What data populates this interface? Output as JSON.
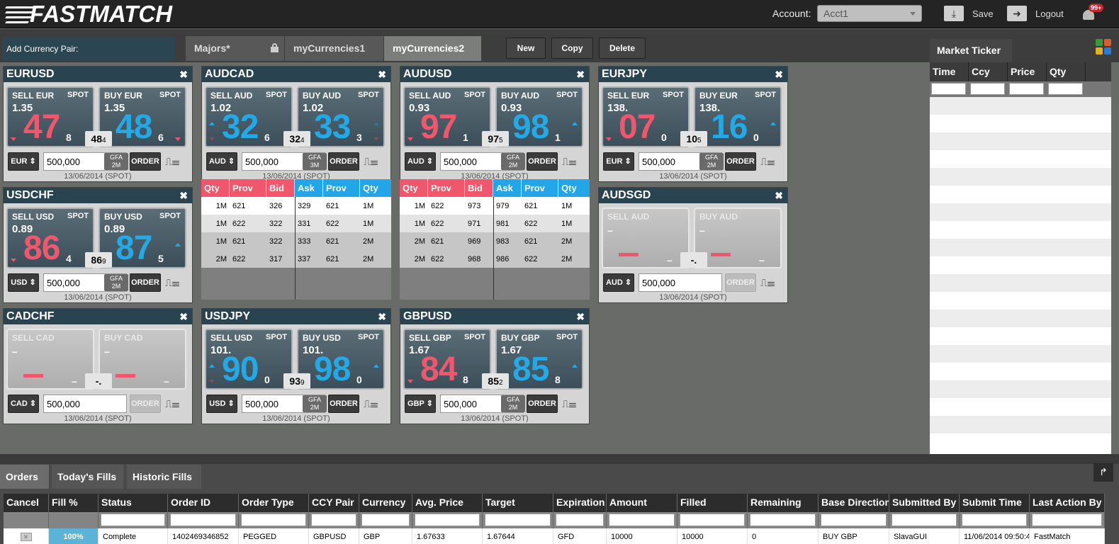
{
  "app": {
    "logo": "FASTMATCH",
    "account_label": "Account:",
    "account_value": "Acct1",
    "save": "Save",
    "logout": "Logout",
    "notifications": "99+"
  },
  "workspace": {
    "add_pair": "Add Currency Pair:",
    "tabs": [
      "Majors*",
      "myCurrencies1",
      "myCurrencies2"
    ],
    "actions": [
      "New",
      "Copy",
      "Delete"
    ]
  },
  "tiles": [
    {
      "pair": "EURUSD",
      "sell": "SELL EUR",
      "buy": "BUY EUR",
      "spot": "SPOT",
      "sell_fig": "1.35",
      "sell_big": "47",
      "sell_pip": "8",
      "buy_fig": "1.35",
      "buy_big": "48",
      "buy_pip": "6",
      "spread": "48",
      "spread_sub": "4",
      "ccy": "EUR",
      "amount": "500,000",
      "gfa": "GFA",
      "gfa2": "2M",
      "order": "ORDER",
      "date": "13/06/2014 (SPOT)"
    },
    {
      "pair": "AUDCAD",
      "sell": "SELL AUD",
      "buy": "BUY AUD",
      "spot": "SPOT",
      "sell_fig": "1.02",
      "sell_big": "32",
      "sell_pip": "6",
      "buy_fig": "1.02",
      "buy_big": "33",
      "buy_pip": "3",
      "spread": "32",
      "spread_sub": "4",
      "ccy": "AUD",
      "amount": "500,000",
      "gfa": "GFA",
      "gfa2": "3M",
      "order": "ORDER",
      "date": "13/06/2014 (SPOT)"
    },
    {
      "pair": "AUDUSD",
      "sell": "SELL AUD",
      "buy": "BUY AUD",
      "spot": "SPOT",
      "sell_fig": "0.93",
      "sell_big": "97",
      "sell_pip": "1",
      "buy_fig": "0.93",
      "buy_big": "98",
      "buy_pip": "1",
      "spread": "97",
      "spread_sub": "5",
      "ccy": "AUD",
      "amount": "500,000",
      "gfa": "GFA",
      "gfa2": "2M",
      "order": "ORDER",
      "date": "13/06/2014 (SPOT)"
    },
    {
      "pair": "EURJPY",
      "sell": "SELL EUR",
      "buy": "BUY EUR",
      "spot": "SPOT",
      "sell_fig": "138.",
      "sell_big": "07",
      "sell_pip": "0",
      "buy_fig": "138.",
      "buy_big": "16",
      "buy_pip": "0",
      "spread": "10",
      "spread_sub": "5",
      "ccy": "EUR",
      "amount": "500,000",
      "gfa": "GFA",
      "gfa2": "2M",
      "order": "ORDER",
      "date": "13/06/2014 (SPOT)"
    },
    {
      "pair": "USDCHF",
      "sell": "SELL USD",
      "buy": "BUY USD",
      "spot": "SPOT",
      "sell_fig": "0.89",
      "sell_big": "86",
      "sell_pip": "4",
      "buy_fig": "0.89",
      "buy_big": "87",
      "buy_pip": "5",
      "spread": "86",
      "spread_sub": "9",
      "ccy": "USD",
      "amount": "500,000",
      "gfa": "GFA",
      "gfa2": "2M",
      "order": "ORDER",
      "date": "13/06/2014 (SPOT)"
    },
    {
      "pair": "AUDSGD",
      "sell": "SELL AUD",
      "buy": "BUY AUD",
      "dash": "–",
      "spread": "-.",
      "ccy": "AUD",
      "amount": "500,000",
      "order": "ORDER",
      "date": "13/06/2014 (SPOT)"
    },
    {
      "pair": "CADCHF",
      "sell": "SELL CAD",
      "buy": "BUY CAD",
      "dash": "–",
      "spread": "-.",
      "ccy": "CAD",
      "amount": "500,000",
      "order": "ORDER",
      "date": "13/06/2014 (SPOT)"
    },
    {
      "pair": "USDJPY",
      "sell": "SELL USD",
      "buy": "BUY USD",
      "spot": "SPOT",
      "sell_fig": "101.",
      "sell_big": "90",
      "sell_pip": "0",
      "buy_fig": "101.",
      "buy_big": "98",
      "buy_pip": "0",
      "spread": "93",
      "spread_sub": "9",
      "ccy": "USD",
      "amount": "500,000",
      "gfa": "GFA",
      "gfa2": "2M",
      "order": "ORDER",
      "date": "13/06/2014 (SPOT)"
    },
    {
      "pair": "GBPUSD",
      "sell": "SELL GBP",
      "buy": "BUY GBP",
      "spot": "SPOT",
      "sell_fig": "1.67",
      "sell_big": "84",
      "sell_pip": "8",
      "buy_fig": "1.67",
      "buy_big": "85",
      "buy_pip": "8",
      "spread": "85",
      "spread_sub": "2",
      "ccy": "GBP",
      "amount": "500,000",
      "gfa": "GFA",
      "gfa2": "2M",
      "order": "ORDER",
      "date": "13/06/2014 (SPOT)"
    }
  ],
  "depth_headers": [
    "Qty",
    "Prov",
    "Bid",
    "Ask",
    "Prov",
    "Qty"
  ],
  "depth": [
    {
      "rows": [
        [
          "1M",
          "621",
          "326",
          "329",
          "621",
          "1M"
        ],
        [
          "1M",
          "622",
          "322",
          "331",
          "622",
          "1M"
        ],
        [
          "1M",
          "621",
          "322",
          "333",
          "621",
          "2M"
        ],
        [
          "2M",
          "622",
          "317",
          "337",
          "621",
          "2M"
        ]
      ]
    },
    {
      "rows": [
        [
          "1M",
          "622",
          "973",
          "979",
          "621",
          "1M"
        ],
        [
          "1M",
          "622",
          "971",
          "981",
          "622",
          "1M"
        ],
        [
          "2M",
          "621",
          "969",
          "983",
          "621",
          "2M"
        ],
        [
          "2M",
          "622",
          "968",
          "986",
          "622",
          "2M"
        ]
      ]
    }
  ],
  "ticker": {
    "title": "Market Ticker",
    "headers": [
      "Time",
      "Ccy",
      "Price",
      "Qty"
    ]
  },
  "orders": {
    "tabs": [
      "Orders",
      "Today's Fills",
      "Historic Fills"
    ],
    "headers": [
      "Cancel",
      "Fill %",
      "Status",
      "Order ID",
      "Order Type",
      "CCY Pair",
      "Currency",
      "Avg. Price",
      "Target",
      "Expiration",
      "Amount",
      "Filled",
      "Remaining",
      "Base Direction",
      "Submitted By",
      "Submit Time",
      "Last Action By"
    ],
    "row": [
      "✕",
      "100%",
      "Complete",
      "1402469346852",
      "PEGGED",
      "GBPUSD",
      "GBP",
      "1.67633",
      "1.67644",
      "GFD",
      "10000",
      "10000",
      "0",
      "BUY GBP",
      "SlavaGUI",
      "11/06/2014 09:50:4",
      "FastMatch"
    ]
  },
  "colors": {
    "sell": "#f0566c",
    "buy": "#23a9e6",
    "tile_head": "#2a4351"
  }
}
